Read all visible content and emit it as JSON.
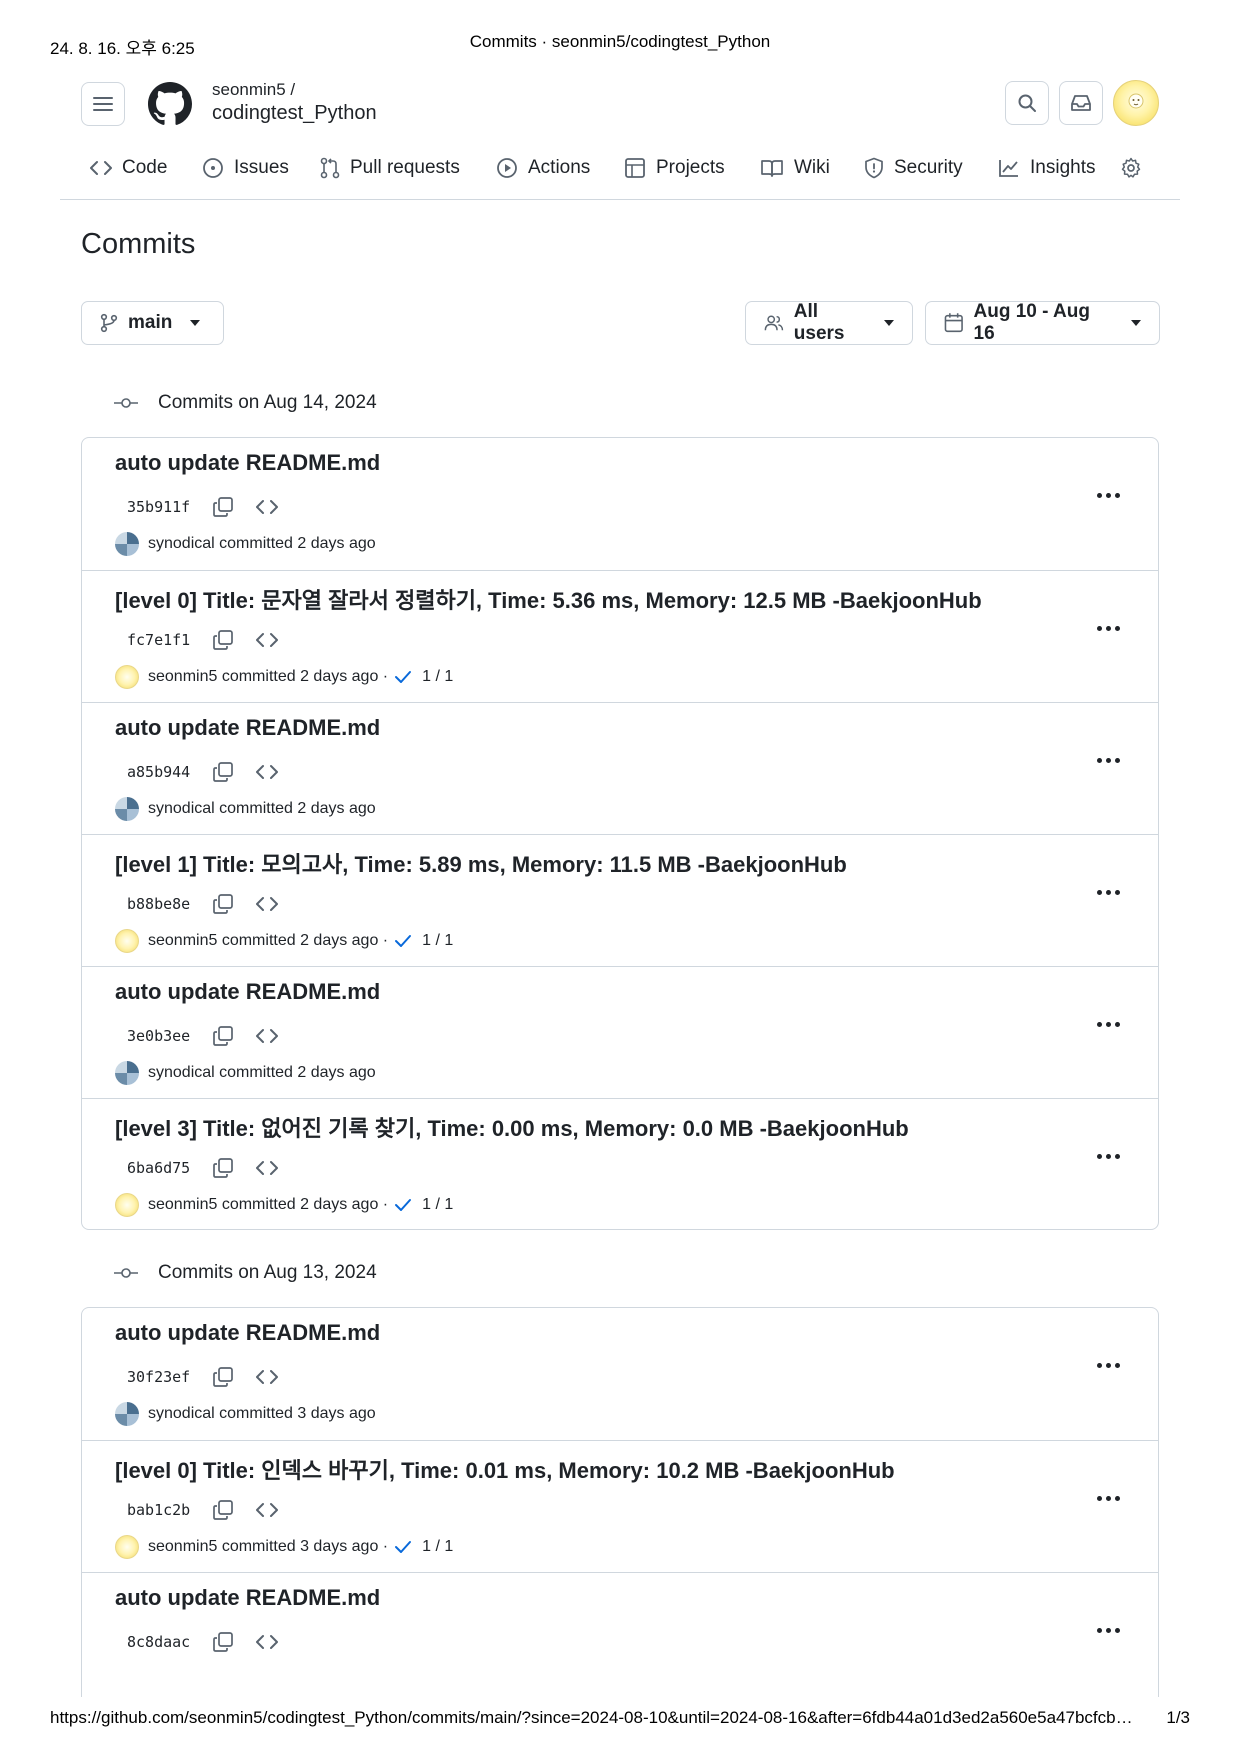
{
  "print": {
    "date": "24. 8. 16. 오후 6:25",
    "title": "Commits · seonmin5/codingtest_Python",
    "url": "https://github.com/seonmin5/codingtest_Python/commits/main/?since=2024-08-10&until=2024-08-16&after=6fdb44a01d3ed2a560e5a47bcfcbc75…",
    "page": "1/3"
  },
  "header": {
    "owner": "seonmin5 /",
    "repo": "codingtest_Python"
  },
  "tabs": [
    {
      "label": "Code",
      "icon": "code-icon"
    },
    {
      "label": "Issues",
      "icon": "issue-icon"
    },
    {
      "label": "Pull requests",
      "icon": "pull-request-icon"
    },
    {
      "label": "Actions",
      "icon": "play-icon"
    },
    {
      "label": "Projects",
      "icon": "table-icon"
    },
    {
      "label": "Wiki",
      "icon": "book-icon"
    },
    {
      "label": "Security",
      "icon": "shield-icon"
    },
    {
      "label": "Insights",
      "icon": "graph-icon"
    }
  ],
  "page_title": "Commits",
  "filters": {
    "branch": "main",
    "users": "All users",
    "date_range": "Aug 10 - Aug 16"
  },
  "groups": [
    {
      "date_label": "Commits on Aug 14, 2024",
      "commits": [
        {
          "title": "auto update README.md",
          "sha": "35b911f",
          "author": "synodical",
          "when": "committed 2 days ago",
          "checks": null
        },
        {
          "title": "[level 0] Title: 문자열 잘라서 정렬하기, Time: 5.36 ms, Memory: 12.5 MB -BaekjoonHub",
          "sha": "fc7e1f1",
          "author": "seonmin5",
          "when": "committed 2 days ago ·",
          "checks": "1 / 1"
        },
        {
          "title": "auto update README.md",
          "sha": "a85b944",
          "author": "synodical",
          "when": "committed 2 days ago",
          "checks": null
        },
        {
          "title": "[level 1] Title: 모의고사, Time: 5.89 ms, Memory: 11.5 MB -BaekjoonHub",
          "sha": "b88be8e",
          "author": "seonmin5",
          "when": "committed 2 days ago ·",
          "checks": "1 / 1"
        },
        {
          "title": "auto update README.md",
          "sha": "3e0b3ee",
          "author": "synodical",
          "when": "committed 2 days ago",
          "checks": null
        },
        {
          "title": "[level 3] Title: 없어진 기록 찾기, Time: 0.00 ms, Memory: 0.0 MB -BaekjoonHub",
          "sha": "6ba6d75",
          "author": "seonmin5",
          "when": "committed 2 days ago ·",
          "checks": "1 / 1"
        }
      ]
    },
    {
      "date_label": "Commits on Aug 13, 2024",
      "commits": [
        {
          "title": "auto update README.md",
          "sha": "30f23ef",
          "author": "synodical",
          "when": "committed 3 days ago",
          "checks": null
        },
        {
          "title": "[level 0] Title: 인덱스 바꾸기, Time: 0.01 ms, Memory: 10.2 MB -BaekjoonHub",
          "sha": "bab1c2b",
          "author": "seonmin5",
          "when": "committed 3 days ago ·",
          "checks": "1 / 1"
        },
        {
          "title": "auto update README.md",
          "sha": "8c8daac",
          "author": null,
          "when": null,
          "checks": null
        }
      ]
    }
  ]
}
